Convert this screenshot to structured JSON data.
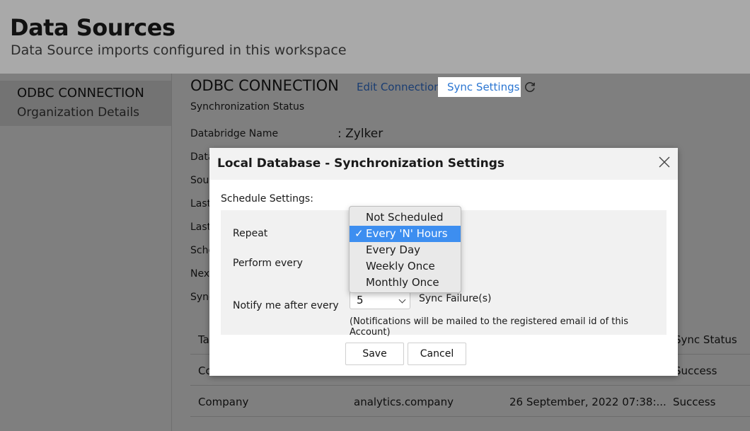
{
  "header": {
    "title": "Data Sources",
    "subtitle": "Data Source imports configured in this workspace"
  },
  "sidebar": {
    "item_title": "ODBC CONNECTION",
    "item_subtitle": "Organization Details"
  },
  "main": {
    "connection_title": "ODBC CONNECTION",
    "edit_connection": "Edit Connection",
    "sync_settings": "Sync Settings",
    "sync_status_label": "Synchronization Status",
    "databridge_label": "Databridge Name",
    "databridge_value": ": Zylker",
    "partial_labels": [
      "Data",
      "Sour",
      "Last",
      "Last",
      "Sche",
      "Next",
      "Sync"
    ],
    "table_header_partial": "Ta",
    "table_header_sync_status": "Sync Status",
    "rows": [
      {
        "name_partial": "Co",
        "status": "Success"
      },
      {
        "name": "Company",
        "table": "analytics.company",
        "time": "26 September, 2022 07:38:...",
        "status": "Success"
      }
    ]
  },
  "modal": {
    "title": "Local Database - Synchronization Settings",
    "schedule_label": "Schedule Settings:",
    "repeat_label": "Repeat",
    "perform_label": "Perform every",
    "notify_label": "Notify me after every",
    "notify_value": "5",
    "sync_failures": "Sync Failure(s)",
    "note": "(Notifications will be mailed to the registered email id of this Account)",
    "save": "Save",
    "cancel": "Cancel"
  },
  "dropdown": {
    "options": [
      "Not Scheduled",
      "Every 'N' Hours",
      "Every Day",
      "Weekly Once",
      "Monthly Once"
    ],
    "selected_index": 1,
    "check_mark": "✓"
  },
  "colors": {
    "link": "#1a3d72",
    "sync_tab_text": "#2b76d2",
    "selected_option": "#3d8ef0"
  }
}
